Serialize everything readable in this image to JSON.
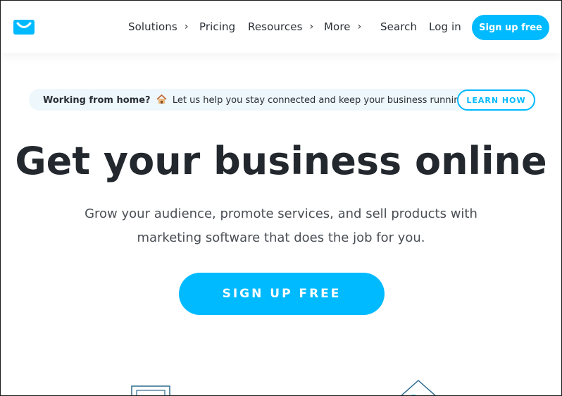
{
  "brand": {
    "logo": "getresponse-logo-icon",
    "accent": "#00baff"
  },
  "nav": {
    "items": [
      {
        "label": "Solutions",
        "has_chevron": true
      },
      {
        "label": "Pricing",
        "has_chevron": false
      },
      {
        "label": "Resources",
        "has_chevron": true
      },
      {
        "label": "More",
        "has_chevron": true
      },
      {
        "label": "Search",
        "has_chevron": false
      },
      {
        "label": "Log in",
        "has_chevron": false
      }
    ],
    "chevron": "›",
    "signup_label": "Sign up free"
  },
  "banner": {
    "lead": "Working from home?",
    "icon": "house-icon",
    "text": "Let us help you stay connected and keep your business running.",
    "button_label": "LEARN HOW"
  },
  "hero": {
    "title": "Get your business online",
    "subtitle_line1": "Grow your audience, promote services, and sell products with",
    "subtitle_line2": "marketing software that does the job for you.",
    "cta_label": "SIGN UP FREE"
  },
  "colors": {
    "text_dark": "#23282e",
    "text_muted": "#4a4f55",
    "banner_bg": "#eef7fc"
  }
}
